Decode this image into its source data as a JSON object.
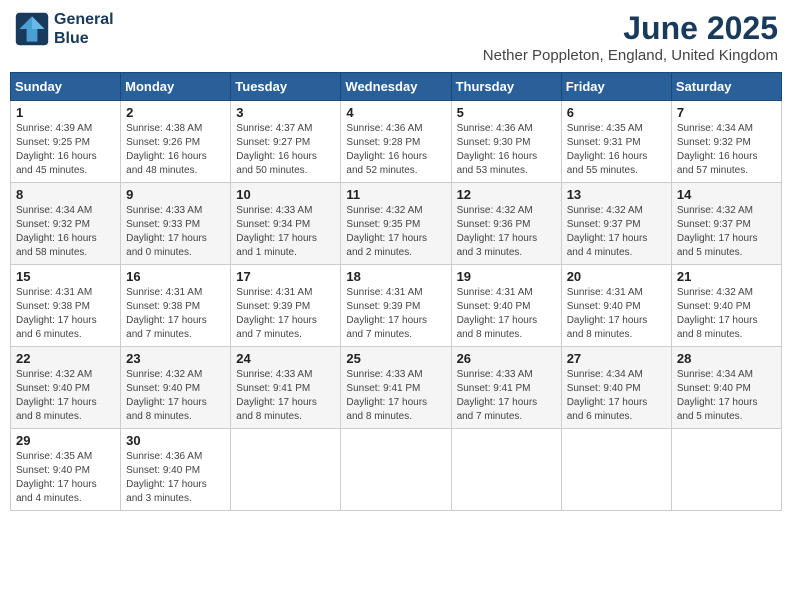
{
  "logo": {
    "line1": "General",
    "line2": "Blue"
  },
  "title": "June 2025",
  "location": "Nether Poppleton, England, United Kingdom",
  "days_of_week": [
    "Sunday",
    "Monday",
    "Tuesday",
    "Wednesday",
    "Thursday",
    "Friday",
    "Saturday"
  ],
  "weeks": [
    [
      {
        "day": "1",
        "sunrise": "4:39 AM",
        "sunset": "9:25 PM",
        "daylight": "16 hours and 45 minutes."
      },
      {
        "day": "2",
        "sunrise": "4:38 AM",
        "sunset": "9:26 PM",
        "daylight": "16 hours and 48 minutes."
      },
      {
        "day": "3",
        "sunrise": "4:37 AM",
        "sunset": "9:27 PM",
        "daylight": "16 hours and 50 minutes."
      },
      {
        "day": "4",
        "sunrise": "4:36 AM",
        "sunset": "9:28 PM",
        "daylight": "16 hours and 52 minutes."
      },
      {
        "day": "5",
        "sunrise": "4:36 AM",
        "sunset": "9:30 PM",
        "daylight": "16 hours and 53 minutes."
      },
      {
        "day": "6",
        "sunrise": "4:35 AM",
        "sunset": "9:31 PM",
        "daylight": "16 hours and 55 minutes."
      },
      {
        "day": "7",
        "sunrise": "4:34 AM",
        "sunset": "9:32 PM",
        "daylight": "16 hours and 57 minutes."
      }
    ],
    [
      {
        "day": "8",
        "sunrise": "4:34 AM",
        "sunset": "9:32 PM",
        "daylight": "16 hours and 58 minutes."
      },
      {
        "day": "9",
        "sunrise": "4:33 AM",
        "sunset": "9:33 PM",
        "daylight": "17 hours and 0 minutes."
      },
      {
        "day": "10",
        "sunrise": "4:33 AM",
        "sunset": "9:34 PM",
        "daylight": "17 hours and 1 minute."
      },
      {
        "day": "11",
        "sunrise": "4:32 AM",
        "sunset": "9:35 PM",
        "daylight": "17 hours and 2 minutes."
      },
      {
        "day": "12",
        "sunrise": "4:32 AM",
        "sunset": "9:36 PM",
        "daylight": "17 hours and 3 minutes."
      },
      {
        "day": "13",
        "sunrise": "4:32 AM",
        "sunset": "9:37 PM",
        "daylight": "17 hours and 4 minutes."
      },
      {
        "day": "14",
        "sunrise": "4:32 AM",
        "sunset": "9:37 PM",
        "daylight": "17 hours and 5 minutes."
      }
    ],
    [
      {
        "day": "15",
        "sunrise": "4:31 AM",
        "sunset": "9:38 PM",
        "daylight": "17 hours and 6 minutes."
      },
      {
        "day": "16",
        "sunrise": "4:31 AM",
        "sunset": "9:38 PM",
        "daylight": "17 hours and 7 minutes."
      },
      {
        "day": "17",
        "sunrise": "4:31 AM",
        "sunset": "9:39 PM",
        "daylight": "17 hours and 7 minutes."
      },
      {
        "day": "18",
        "sunrise": "4:31 AM",
        "sunset": "9:39 PM",
        "daylight": "17 hours and 7 minutes."
      },
      {
        "day": "19",
        "sunrise": "4:31 AM",
        "sunset": "9:40 PM",
        "daylight": "17 hours and 8 minutes."
      },
      {
        "day": "20",
        "sunrise": "4:31 AM",
        "sunset": "9:40 PM",
        "daylight": "17 hours and 8 minutes."
      },
      {
        "day": "21",
        "sunrise": "4:32 AM",
        "sunset": "9:40 PM",
        "daylight": "17 hours and 8 minutes."
      }
    ],
    [
      {
        "day": "22",
        "sunrise": "4:32 AM",
        "sunset": "9:40 PM",
        "daylight": "17 hours and 8 minutes."
      },
      {
        "day": "23",
        "sunrise": "4:32 AM",
        "sunset": "9:40 PM",
        "daylight": "17 hours and 8 minutes."
      },
      {
        "day": "24",
        "sunrise": "4:33 AM",
        "sunset": "9:41 PM",
        "daylight": "17 hours and 8 minutes."
      },
      {
        "day": "25",
        "sunrise": "4:33 AM",
        "sunset": "9:41 PM",
        "daylight": "17 hours and 8 minutes."
      },
      {
        "day": "26",
        "sunrise": "4:33 AM",
        "sunset": "9:41 PM",
        "daylight": "17 hours and 7 minutes."
      },
      {
        "day": "27",
        "sunrise": "4:34 AM",
        "sunset": "9:40 PM",
        "daylight": "17 hours and 6 minutes."
      },
      {
        "day": "28",
        "sunrise": "4:34 AM",
        "sunset": "9:40 PM",
        "daylight": "17 hours and 5 minutes."
      }
    ],
    [
      {
        "day": "29",
        "sunrise": "4:35 AM",
        "sunset": "9:40 PM",
        "daylight": "17 hours and 4 minutes."
      },
      {
        "day": "30",
        "sunrise": "4:36 AM",
        "sunset": "9:40 PM",
        "daylight": "17 hours and 3 minutes."
      },
      null,
      null,
      null,
      null,
      null
    ]
  ]
}
